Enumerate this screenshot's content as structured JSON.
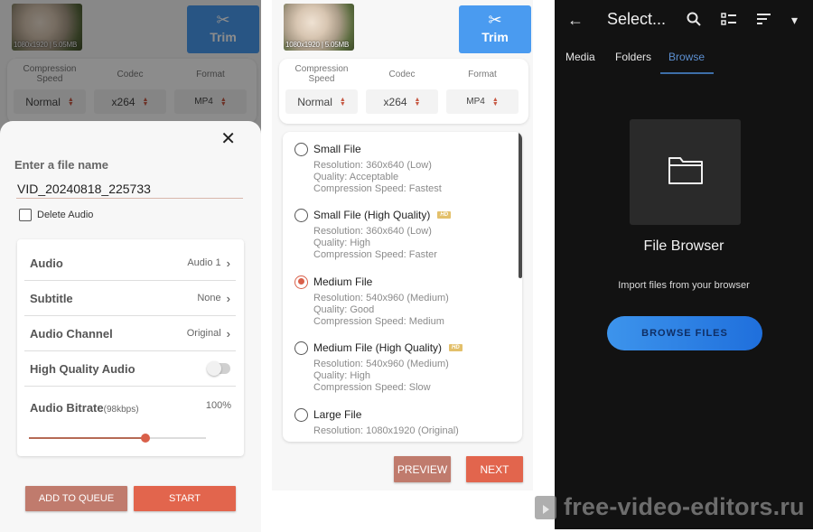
{
  "panel_compress": {
    "thumbnail_label": "1080x1920 | 5.05MB",
    "trim_label": "Trim",
    "columns": [
      {
        "header": "Compression Speed",
        "value": "Normal"
      },
      {
        "header": "Codec",
        "value": "x264"
      },
      {
        "header": "Format",
        "value": "MP4"
      }
    ]
  },
  "save_sheet": {
    "file_name_label": "Enter a file name",
    "file_name_value": "VID_20240818_225733",
    "delete_audio_label": "Delete Audio",
    "delete_audio_checked": false,
    "options": [
      {
        "label": "Audio",
        "value": "Audio 1"
      },
      {
        "label": "Subtitle",
        "value": "None"
      },
      {
        "label": "Audio Channel",
        "value": "Original"
      }
    ],
    "high_quality_audio_label": "High Quality Audio",
    "high_quality_audio_on": false,
    "bitrate_label": "Audio Bitrate",
    "bitrate_sub": "(98kbps)",
    "bitrate_percent_label": "100%",
    "bitrate_slider_fraction": 0.66,
    "add_to_queue_label": "ADD TO QUEUE",
    "start_label": "START"
  },
  "presets_panel": {
    "presets": [
      {
        "title": "Small File",
        "hd": false,
        "selected": false,
        "details": [
          "Resolution: 360x640 (Low)",
          "Quality: Acceptable",
          "Compression Speed: Fastest"
        ]
      },
      {
        "title": "Small File (High Quality)",
        "hd": true,
        "selected": false,
        "details": [
          "Resolution: 360x640 (Low)",
          "Quality: High",
          "Compression Speed: Faster"
        ]
      },
      {
        "title": "Medium File",
        "hd": false,
        "selected": true,
        "details": [
          "Resolution: 540x960 (Medium)",
          "Quality: Good",
          "Compression Speed: Medium"
        ]
      },
      {
        "title": "Medium File (High Quality)",
        "hd": true,
        "selected": false,
        "details": [
          "Resolution: 540x960 (Medium)",
          "Quality: High",
          "Compression Speed: Slow"
        ]
      },
      {
        "title": "Large File",
        "hd": false,
        "selected": false,
        "details": [
          "Resolution: 1080x1920 (Original)"
        ]
      }
    ],
    "hd_badge": "HD",
    "preview_label": "PREVIEW",
    "next_label": "NEXT"
  },
  "file_picker": {
    "title": "Select...",
    "tabs": [
      "Media",
      "Folders",
      "Browse"
    ],
    "active_tab": "Browse",
    "section_title": "File Browser",
    "section_subtitle": "Import files from your browser",
    "browse_button_label": "BROWSE FILES"
  },
  "icons": {
    "back": "←",
    "search": "⌕",
    "list_view": "☷",
    "sort": "≡",
    "dropdown": "▾",
    "close": "✕",
    "chevron_right": "›",
    "scissors": "✂"
  },
  "watermark": "free-video-editors.ru",
  "colors": {
    "accent": "#e2654d",
    "accent_muted": "#c07b6d",
    "trim_blue": "#4a9bf0",
    "browse_blue": "#1f6fdc",
    "hd_gold": "#e3c06b",
    "dark_bg": "#121212"
  }
}
